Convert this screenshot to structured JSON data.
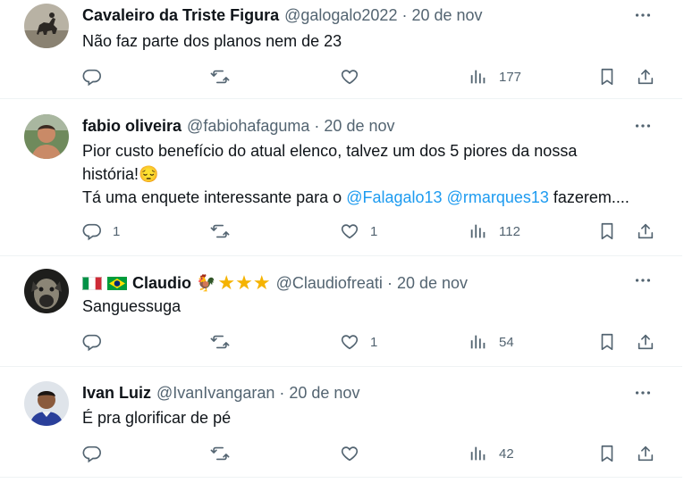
{
  "tweets": [
    {
      "name": "Cavaleiro da Triste Figura",
      "handle": "@galogalo2022",
      "dot": "·",
      "date": "20 de nov",
      "text1": "Não faz parte dos planos nem de 23",
      "replies": "",
      "retweets": "",
      "likes": "",
      "views": "177"
    },
    {
      "name": "fabio oliveira",
      "handle": "@fabiohafaguma",
      "dot": "·",
      "date": "20 de nov",
      "text1": "Pior custo benefício do atual elenco, talvez um dos 5 piores da nossa",
      "text2": "história!",
      "text2_emoji": "😔",
      "text3_a": "Tá uma enquete interessante para o ",
      "mention1": "@Falagalo13",
      "mention2": "@rmarques13",
      "text3_b": " fazerem....",
      "replies": "1",
      "retweets": "",
      "likes": "1",
      "views": "112"
    },
    {
      "name": "Claudio",
      "name_emoji": "🐓",
      "stars": "★★★",
      "handle": "@Claudiofreati",
      "dot": "·",
      "date": "20 de nov",
      "text1": "Sanguessuga",
      "replies": "",
      "retweets": "",
      "likes": "1",
      "views": "54"
    },
    {
      "name": "Ivan Luiz",
      "handle": "@IvanIvangaran",
      "dot": "·",
      "date": "20 de nov",
      "text1": "É pra glorificar de pé",
      "replies": "",
      "retweets": "",
      "likes": "",
      "views": "42"
    }
  ],
  "icons": [
    "more-icon",
    "reply-icon",
    "retweet-icon",
    "like-icon",
    "views-icon",
    "bookmark-icon",
    "share-icon"
  ],
  "colors": {
    "text": "#0f1419",
    "secondary": "#536471",
    "link": "#1d9bf0",
    "divider": "#eff3f4"
  }
}
